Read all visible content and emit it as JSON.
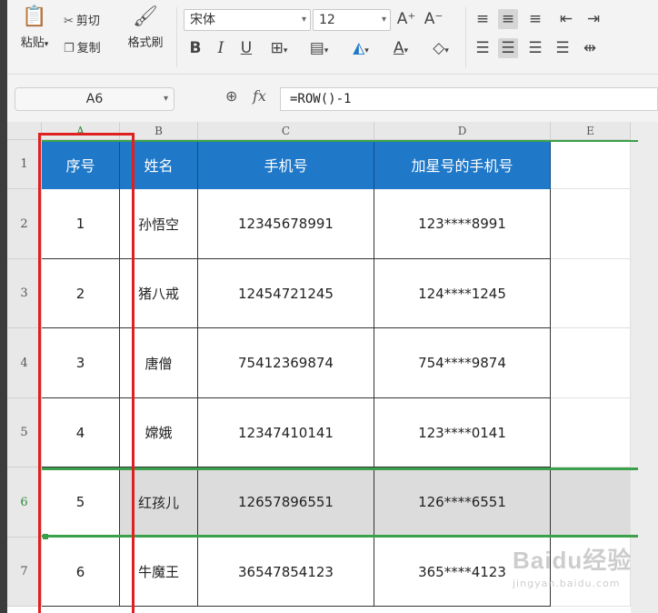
{
  "ribbon": {
    "paste_label": "粘贴",
    "cut_label": "剪切",
    "copy_label": "复制",
    "format_painter_label": "格式刷",
    "font_name": "宋体",
    "font_size": "12",
    "grow_font": "A⁺",
    "shrink_font": "A⁻",
    "bold": "B",
    "italic": "I",
    "underline": "U"
  },
  "formula_bar": {
    "name_box": "A6",
    "zoom_icon": "magnifier-icon",
    "fx_label": "fx",
    "formula": "=ROW()-1"
  },
  "sheet": {
    "columns": [
      "A",
      "B",
      "C",
      "D",
      "E"
    ],
    "row_numbers": [
      "1",
      "2",
      "3",
      "4",
      "5",
      "6",
      "7"
    ],
    "selected_row": "6",
    "header": {
      "seq": "序号",
      "name": "姓名",
      "phone": "手机号",
      "masked": "加星号的手机号"
    },
    "rows": [
      {
        "seq": "1",
        "name": "孙悟空",
        "phone": "12345678991",
        "masked": "123****8991"
      },
      {
        "seq": "2",
        "name": "猪八戒",
        "phone": "12454721245",
        "masked": "124****1245"
      },
      {
        "seq": "3",
        "name": "唐僧",
        "phone": "75412369874",
        "masked": "754****9874"
      },
      {
        "seq": "4",
        "name": "嫦娥",
        "phone": "12347410141",
        "masked": "123****0141"
      },
      {
        "seq": "5",
        "name": "红孩儿",
        "phone": "12657896551",
        "masked": "126****6551"
      },
      {
        "seq": "6",
        "name": "牛魔王",
        "phone": "36547854123",
        "masked": "365****4123"
      }
    ]
  },
  "watermark": {
    "logo": "Baidu经验",
    "url": "jingyan.baidu.com"
  },
  "colors": {
    "header_fill": "#1f78c8",
    "selection_green": "#3aa14a",
    "annotation_red": "#e02020"
  }
}
